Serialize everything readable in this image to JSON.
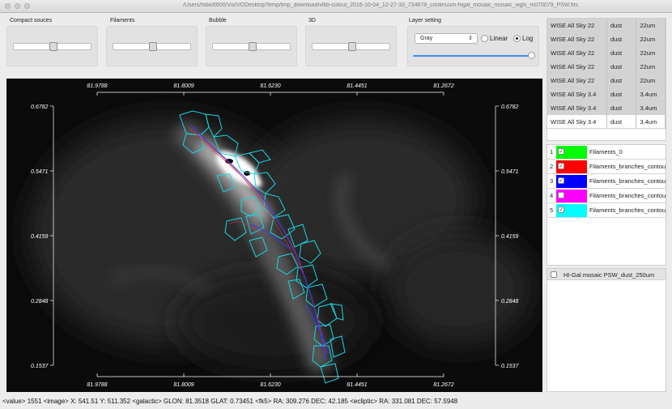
{
  "window": {
    "title": "/Users/fxbio6600/VisIVODesktopTemp/tmp_download/vlkb-cutout_2016-10-04_12-27-33_734678_continuum-higal_mosaic_mosaic_wgls_m070079_PSW.fits"
  },
  "controls": {
    "compact_label": "Compact souces",
    "filaments_label": "Filaments",
    "bubble_label": "Bubble",
    "threed_label": "3D",
    "layer_label": "Layer setting",
    "colormap": "Gray",
    "linear_label": "Linear",
    "log_label": "Log",
    "scale_selected": "Log"
  },
  "axes": {
    "x_ticks": [
      "81.9788",
      "81.8009",
      "81.6230",
      "81.4451",
      "81.2672"
    ],
    "y_ticks": [
      "0.6782",
      "0.5471",
      "0.4159",
      "0.2848",
      "0.1537"
    ]
  },
  "surveys": [
    {
      "name": "WISE All Sky 22",
      "type": "dust",
      "band": "22um"
    },
    {
      "name": "WISE All Sky 22",
      "type": "dust",
      "band": "22um"
    },
    {
      "name": "WISE All Sky 22",
      "type": "dust",
      "band": "22um"
    },
    {
      "name": "WISE All Sky 22",
      "type": "dust",
      "band": "22um"
    },
    {
      "name": "WISE All Sky 22",
      "type": "dust",
      "band": "22um"
    },
    {
      "name": "WISE All Sky 3.4",
      "type": "dust",
      "band": "3.4um"
    },
    {
      "name": "WISE All Sky 3.4",
      "type": "dust",
      "band": "3.4um"
    },
    {
      "name": "WISE All Sky 3.4",
      "type": "dust",
      "band": "3.4um"
    }
  ],
  "layers": [
    {
      "num": "1",
      "checked": true,
      "color": "#00ff00",
      "name": "Filaments_0"
    },
    {
      "num": "2",
      "checked": true,
      "color": "#ff0000",
      "name": "Filaments_branches_contou"
    },
    {
      "num": "3",
      "checked": true,
      "color": "#0000ff",
      "name": "Filaments_branches_contou"
    },
    {
      "num": "4",
      "checked": false,
      "color": "#ff00ff",
      "name": "Filaments_branches_contou"
    },
    {
      "num": "5",
      "checked": true,
      "color": "#00ffff",
      "name": "Filaments_branches_contou"
    }
  ],
  "images": [
    {
      "checked": false,
      "name": "HI-Gal mosaic PSW_dust_250um"
    }
  ],
  "status": "<value> 1551 <image> X: 541.51 Y: 511.352 <galactic> GLON: 81.3518 GLAT: 0.73451 <fk5> RA: 309.276 DEC: 42.185 <ecliptic> RA: 331.081 DEC: 57.5948"
}
